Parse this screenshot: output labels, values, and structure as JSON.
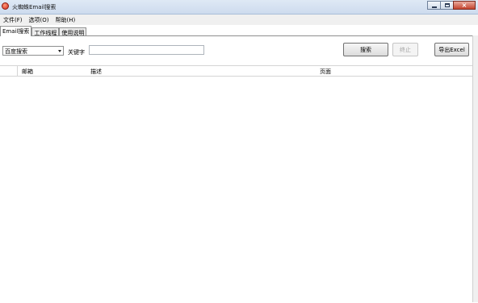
{
  "window": {
    "title": "火蜘蛛Email搜索"
  },
  "menu": {
    "items": [
      "文件(F)",
      "选项(O)",
      "帮助(H)"
    ]
  },
  "tabs": [
    "Email搜索",
    "工作线程",
    "使用说明"
  ],
  "search": {
    "engine_selected": "百度搜索",
    "keyword_label": "关键字",
    "keyword_value": ""
  },
  "buttons": {
    "search": "搜索",
    "stop": "终止",
    "export": "导出Excel"
  },
  "grid": {
    "columns": [
      "邮箱",
      "描述",
      "页面"
    ]
  }
}
